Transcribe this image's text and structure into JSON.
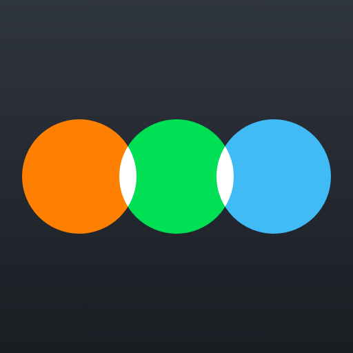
{
  "icon": {
    "name": "three-circles-logo-icon",
    "colors": {
      "background_top": "#2f353f",
      "background_bottom": "#1a1d22",
      "left_circle": "#ff7f00",
      "middle_circle": "#00e055",
      "right_circle": "#40bbf5",
      "overlap": "#ffffff"
    }
  }
}
